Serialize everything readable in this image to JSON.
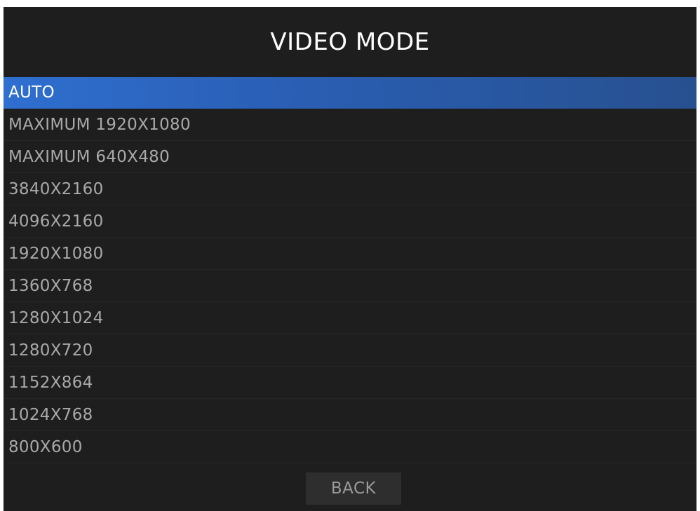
{
  "title": "VIDEO MODE",
  "modes": [
    {
      "label": "AUTO",
      "selected": true
    },
    {
      "label": "MAXIMUM 1920X1080",
      "selected": false
    },
    {
      "label": "MAXIMUM 640X480",
      "selected": false
    },
    {
      "label": "3840X2160",
      "selected": false
    },
    {
      "label": "4096X2160",
      "selected": false
    },
    {
      "label": "1920X1080",
      "selected": false
    },
    {
      "label": "1360X768",
      "selected": false
    },
    {
      "label": "1280X1024",
      "selected": false
    },
    {
      "label": "1280X720",
      "selected": false
    },
    {
      "label": "1152X864",
      "selected": false
    },
    {
      "label": "1024X768",
      "selected": false
    },
    {
      "label": "800X600",
      "selected": false
    }
  ],
  "back_label": "BACK",
  "colors": {
    "background": "#1e1e1e",
    "selected_highlight": "#2f6fd0",
    "item_text": "#a9a9a9",
    "selected_text": "#ffffff"
  }
}
